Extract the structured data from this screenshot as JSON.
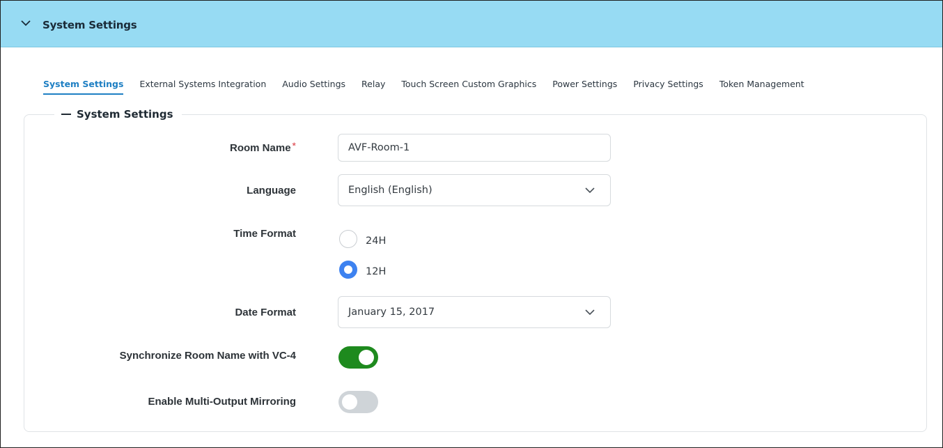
{
  "header": {
    "title": "System Settings"
  },
  "tabs": [
    {
      "label": "System Settings",
      "active": true
    },
    {
      "label": "External Systems Integration",
      "active": false
    },
    {
      "label": "Audio Settings",
      "active": false
    },
    {
      "label": "Relay",
      "active": false
    },
    {
      "label": "Touch Screen Custom Graphics",
      "active": false
    },
    {
      "label": "Power Settings",
      "active": false
    },
    {
      "label": "Privacy Settings",
      "active": false
    },
    {
      "label": "Token Management",
      "active": false
    }
  ],
  "section": {
    "legend": "System Settings"
  },
  "form": {
    "room_name": {
      "label": "Room Name",
      "required_mark": "*",
      "value": "AVF-Room-1"
    },
    "language": {
      "label": "Language",
      "value": "English (English)"
    },
    "time_format": {
      "label": "Time Format",
      "options": [
        {
          "label": "24H",
          "checked": false
        },
        {
          "label": "12H",
          "checked": true
        }
      ]
    },
    "date_format": {
      "label": "Date Format",
      "value": "January 15, 2017"
    },
    "sync_room_name": {
      "label": "Synchronize Room Name with VC-4",
      "enabled": true
    },
    "multi_output_mirroring": {
      "label": "Enable Multi-Output Mirroring",
      "enabled": false
    }
  },
  "colors": {
    "header_bg": "#97dbf3",
    "accent": "#1e7fc3",
    "radio_checked": "#3d82f0",
    "toggle_on": "#1e8a1e",
    "toggle_off": "#cfd4d8",
    "required": "#d9363e"
  },
  "icons": {
    "header_toggle": "chevron-down-icon",
    "select_caret": "chevron-down-icon",
    "legend_collapse": "minus-icon"
  }
}
